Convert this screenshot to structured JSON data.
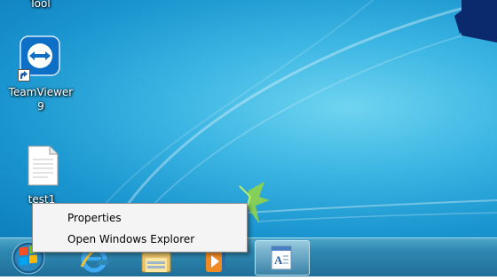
{
  "desktop": {
    "icons": [
      {
        "name": "Tool",
        "label_line1": "Tool",
        "label_line2": ""
      },
      {
        "name": "TeamViewer 9",
        "label_line1": "TeamViewer",
        "label_line2": "9"
      },
      {
        "name": "test1",
        "label_line1": "test1",
        "label_line2": ""
      }
    ]
  },
  "context_menu": {
    "items": [
      {
        "label": "Properties"
      },
      {
        "label": "Open Windows Explorer"
      }
    ]
  },
  "taskbar": {
    "buttons": [
      {
        "icon": "start-orb-icon"
      },
      {
        "icon": "internet-explorer-icon"
      },
      {
        "icon": "folder-icon"
      },
      {
        "icon": "media-player-icon"
      },
      {
        "icon": "wordpad-icon",
        "active": true
      }
    ]
  },
  "colors": {
    "desktop": "#2aa6dc",
    "taskbar": "#2f89b2",
    "menu_bg": "#f4f4f4"
  }
}
